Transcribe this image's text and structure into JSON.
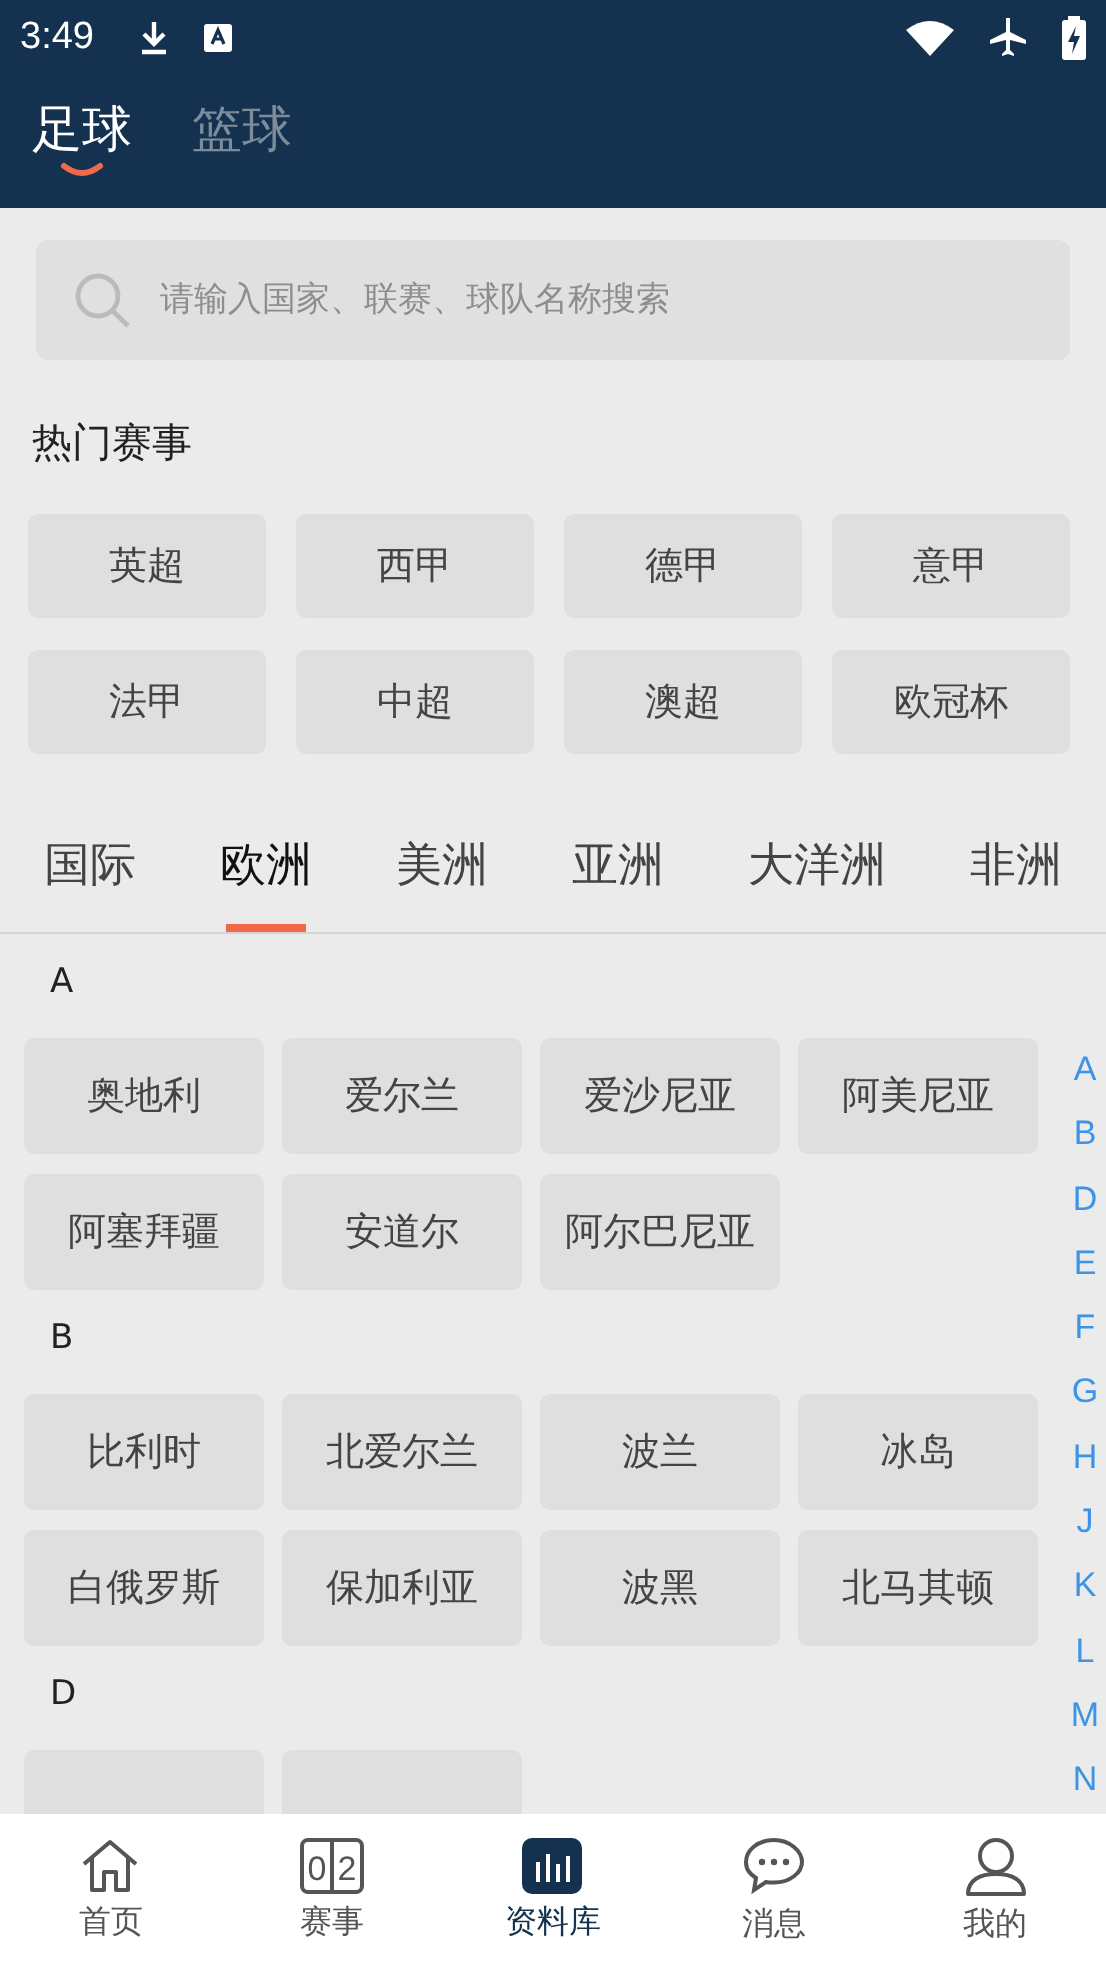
{
  "status_bar": {
    "time": "3:49"
  },
  "sport_tabs": [
    {
      "label": "足球",
      "selected": true
    },
    {
      "label": "篮球",
      "selected": false
    }
  ],
  "search": {
    "placeholder": "请输入国家、联赛、球队名称搜索"
  },
  "hot": {
    "title": "热门赛事",
    "items": [
      "英超",
      "西甲",
      "德甲",
      "意甲",
      "法甲",
      "中超",
      "澳超",
      "欧冠杯"
    ]
  },
  "region_tabs": [
    {
      "label": "国际",
      "selected": false
    },
    {
      "label": "欧洲",
      "selected": true
    },
    {
      "label": "美洲",
      "selected": false
    },
    {
      "label": "亚洲",
      "selected": false
    },
    {
      "label": "大洋洲",
      "selected": false
    },
    {
      "label": "非洲",
      "selected": false
    }
  ],
  "groups": [
    {
      "letter": "A",
      "countries": [
        {
          "kind": "name",
          "name": "奥地利"
        },
        {
          "kind": "name",
          "name": "爱尔兰"
        },
        {
          "kind": "name",
          "name": "爱沙尼亚"
        },
        {
          "kind": "name",
          "name": "阿美尼亚"
        },
        {
          "kind": "name",
          "name": "阿塞拜疆"
        },
        {
          "kind": "name",
          "name": "安道尔"
        },
        {
          "kind": "name",
          "name": "阿尔巴尼亚"
        }
      ]
    },
    {
      "letter": "B",
      "countries": [
        {
          "kind": "name",
          "name": "比利时"
        },
        {
          "kind": "name",
          "name": "北爱尔兰"
        },
        {
          "kind": "name",
          "name": "波兰"
        },
        {
          "kind": "name",
          "name": "冰岛"
        },
        {
          "kind": "name",
          "name": "白俄罗斯"
        },
        {
          "kind": "name",
          "name": "保加利亚"
        },
        {
          "kind": "name",
          "name": "波黑"
        },
        {
          "kind": "name",
          "name": "北马其顿"
        }
      ]
    },
    {
      "letter": "D",
      "countries": [
        {
          "kind": "cut"
        },
        {
          "kind": "cut"
        }
      ]
    }
  ],
  "index": [
    "A",
    "B",
    "D",
    "E",
    "F",
    "G",
    "H",
    "J",
    "K",
    "L",
    "M",
    "N"
  ],
  "bottom_nav": [
    {
      "kind": "home",
      "label": "首页",
      "selected": false
    },
    {
      "kind": "score",
      "label": "赛事",
      "selected": false,
      "digits": [
        "0",
        "2"
      ]
    },
    {
      "kind": "chart",
      "label": "资料库",
      "selected": true
    },
    {
      "kind": "chat",
      "label": "消息",
      "selected": false
    },
    {
      "kind": "user",
      "label": "我的",
      "selected": false
    }
  ]
}
